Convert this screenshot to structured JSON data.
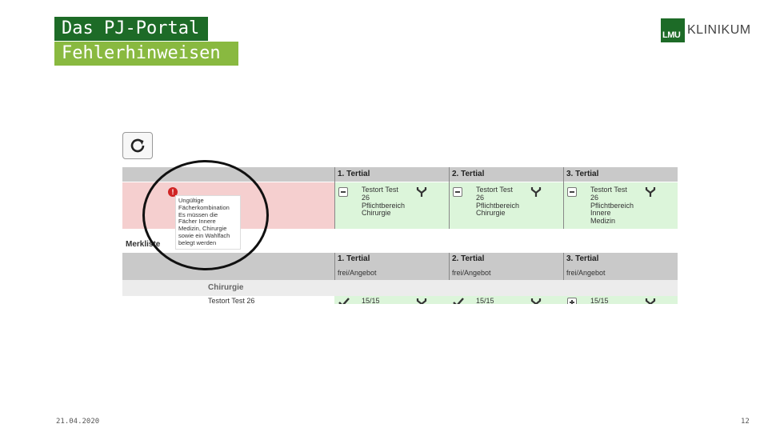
{
  "slide": {
    "title": "Das PJ-Portal",
    "subtitle": "Fehlerhinweisen",
    "date": "21.04.2020",
    "page_number": "12"
  },
  "logo": {
    "mark_text": "LMU",
    "text": "KLINIKUM",
    "color": "#1d6b27"
  },
  "colors": {
    "title_dark_green": "#1d6b27",
    "title_light_green": "#89b940",
    "error_bg": "#f5cfcf",
    "ok_bg": "#dcf5da",
    "header_gray": "#c9c9c9",
    "error_icon": "#d02424"
  },
  "screenshot": {
    "refresh_icon": "refresh-icon",
    "tertial_headers": [
      "1. Tertial",
      "2. Tertial",
      "3. Tertial"
    ],
    "error_tooltip_lines": [
      "Ungültige",
      "Fächerkombination",
      "Es müssen die",
      "Fächer Innere",
      "Medizin, Chirurgie",
      "sowie ein Wahlfach",
      "belegt werden"
    ],
    "slots": [
      {
        "lines": [
          "Testort Test",
          "26",
          "Pflichtbereich",
          "Chirurgie"
        ]
      },
      {
        "lines": [
          "Testort Test",
          "26",
          "Pflichtbereich",
          "Chirurgie"
        ]
      },
      {
        "lines": [
          "Testort Test",
          "26",
          "Pflichtbereich",
          "Innere",
          "Medizin"
        ]
      }
    ],
    "merkliste_label": "Merkliste",
    "merkliste_headers": [
      "1. Tertial",
      "2. Tertial",
      "3. Tertial"
    ],
    "merkliste_sub": [
      "frei/Angebot",
      "frei/Angebot",
      "frei/Angebot"
    ],
    "category": "Chirurgie",
    "bottom_row": {
      "name": "Testort Test 26",
      "counts": [
        "15/15",
        "15/15",
        "15/15"
      ]
    }
  }
}
